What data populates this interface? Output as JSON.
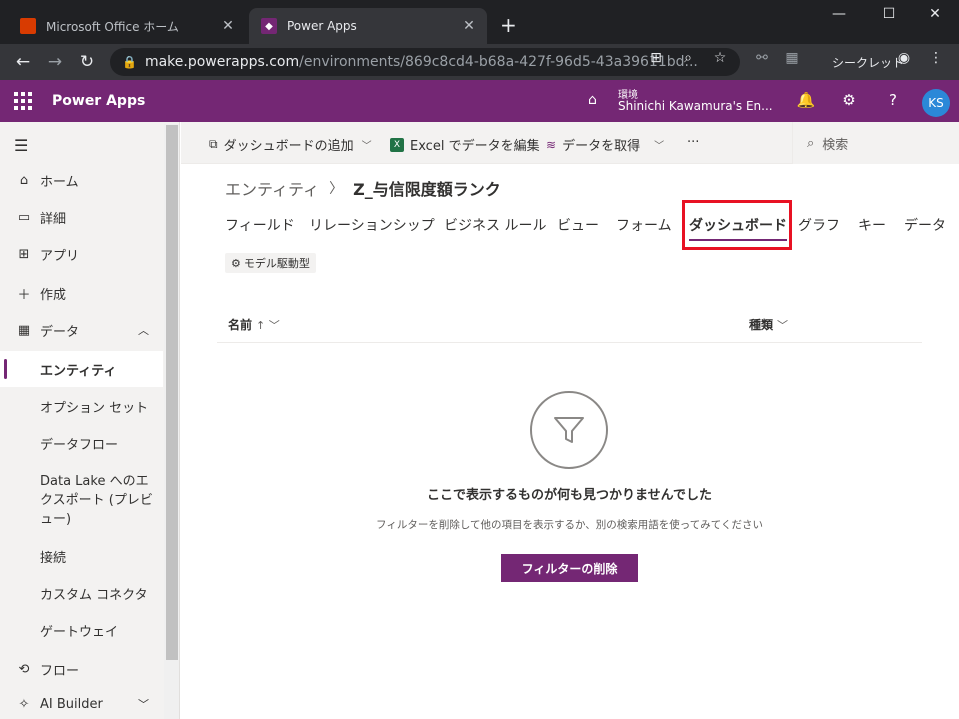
{
  "browser": {
    "tabs": [
      {
        "title": "Microsoft Office ホーム",
        "active": false
      },
      {
        "title": "Power Apps",
        "active": true
      }
    ],
    "url_host": "make.powerapps.com",
    "url_path": "/environments/869c8cd4-b68a-427f-96d5-43a39611bd...",
    "incognito_label": "シークレット"
  },
  "header": {
    "app_name": "Power Apps",
    "env_label": "環境",
    "env_name": "Shinichi Kawamura's En...",
    "avatar": "KS",
    "brand_color": "#742774"
  },
  "sidebar": {
    "items": [
      {
        "label": "ホーム",
        "icon": "home-icon"
      },
      {
        "label": "詳細",
        "icon": "book-icon"
      },
      {
        "label": "アプリ",
        "icon": "apps-icon"
      },
      {
        "label": "作成",
        "icon": "plus-icon"
      },
      {
        "label": "データ",
        "icon": "table-icon"
      },
      {
        "label": "エンティティ"
      },
      {
        "label": "オプション セット"
      },
      {
        "label": "データフロー"
      },
      {
        "label": "Data Lake へのエクスポート (プレビュー)"
      },
      {
        "label": "接続"
      },
      {
        "label": "カスタム コネクタ"
      },
      {
        "label": "ゲートウェイ"
      },
      {
        "label": "フロー",
        "icon": "flow-icon"
      },
      {
        "label": "AI Builder",
        "icon": "ai-icon"
      }
    ]
  },
  "commands": {
    "add_dashboard": "ダッシュボードの追加",
    "edit_excel": "Excel でデータを編集",
    "get_data": "データを取得",
    "more": "···",
    "search_placeholder": "検索"
  },
  "breadcrumb": {
    "parent": "エンティティ",
    "current": "Z_与信限度額ランク"
  },
  "tabs": [
    "フィールド",
    "リレーションシップ",
    "ビジネス ルール",
    "ビュー",
    "フォーム",
    "ダッシュボード",
    "グラフ",
    "キー",
    "データ"
  ],
  "badge": "モデル駆動型",
  "table": {
    "col_name": "名前",
    "col_type": "種類"
  },
  "empty": {
    "title": "ここで表示するものが何も見つかりませんでした",
    "subtitle": "フィルターを削除して他の項目を表示するか、別の検索用語を使ってみてください",
    "button": "フィルターの削除"
  }
}
